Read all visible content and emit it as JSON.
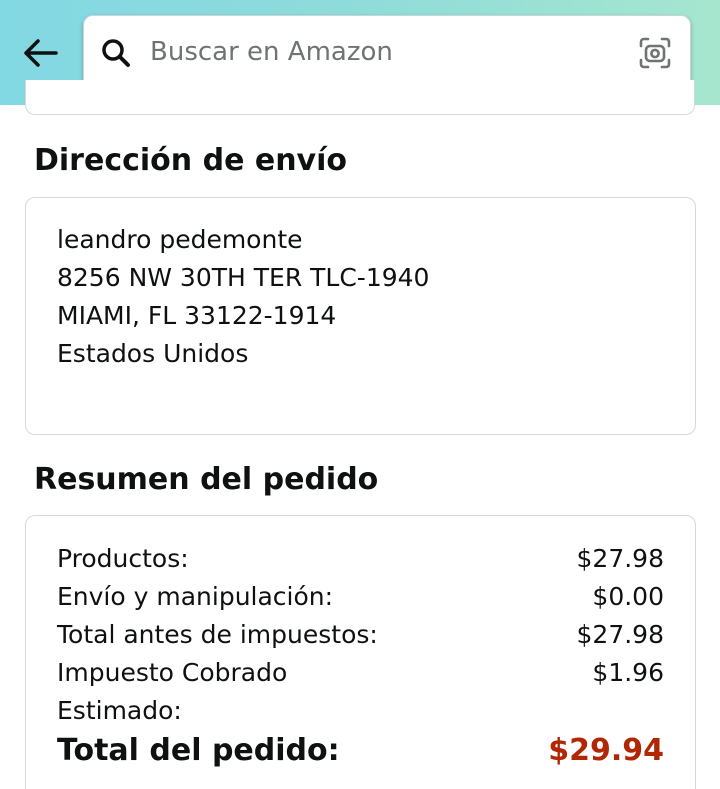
{
  "header": {
    "search_placeholder": "Buscar en Amazon",
    "back_icon": "arrow-left-icon",
    "search_icon": "search-icon",
    "camera_icon": "camera-lens-icon"
  },
  "shipping": {
    "title": "Dirección de envío",
    "name": "leandro pedemonte",
    "street": "8256 NW 30TH TER TLC-1940",
    "city": "MIAMI, FL 33122-1914",
    "country": "Estados Unidos"
  },
  "summary": {
    "title": "Resumen del pedido",
    "rows": [
      {
        "label": "Productos:",
        "value": "$27.98"
      },
      {
        "label": "Envío y manipulación:",
        "value": "$0.00"
      },
      {
        "label": "Total antes de impuestos:",
        "value": "$27.98"
      },
      {
        "label": "Impuesto Cobrado",
        "value": "$1.96"
      },
      {
        "label": "Estimado:",
        "value": ""
      }
    ],
    "total_label": "Total del pedido:",
    "total_value": "$29.94"
  },
  "colors": {
    "header_gradient_start": "#82d8e3",
    "header_gradient_end": "#a6e6cf",
    "total_price": "#b12704",
    "text": "#0f1111",
    "border": "#d5d9d9"
  }
}
